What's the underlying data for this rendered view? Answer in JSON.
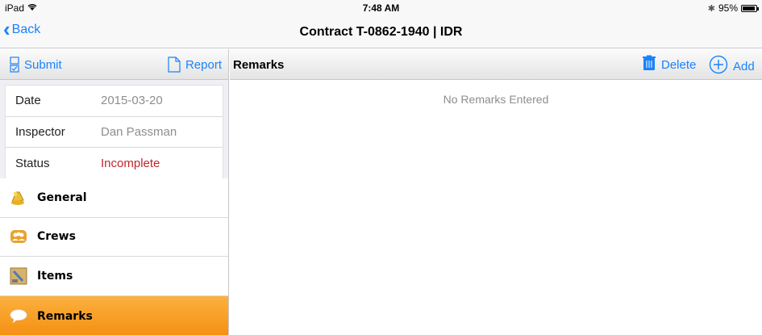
{
  "status_bar": {
    "device": "iPad",
    "time": "7:48 AM",
    "battery": "95%"
  },
  "nav": {
    "back_label": "Back",
    "title": "Contract T-0862-1940 | IDR"
  },
  "left_toolbar": {
    "submit_label": "Submit",
    "report_label": "Report"
  },
  "info": {
    "rows": [
      {
        "label": "Date",
        "value": "2015-03-20"
      },
      {
        "label": "Inspector",
        "value": "Dan Passman"
      },
      {
        "label": "Status",
        "value": "Incomplete"
      }
    ]
  },
  "menu": {
    "items": [
      {
        "label": "General",
        "icon": "general-icon"
      },
      {
        "label": "Crews",
        "icon": "crews-icon"
      },
      {
        "label": "Items",
        "icon": "items-icon"
      },
      {
        "label": "Remarks",
        "icon": "remarks-icon",
        "selected": true
      }
    ]
  },
  "remarks": {
    "title": "Remarks",
    "delete_label": "Delete",
    "add_label": "Add",
    "empty_text": "No Remarks Entered"
  },
  "colors": {
    "accent": "#1a82fb",
    "selected_bg": "#f7a02a",
    "status_incomplete": "#c0262d"
  }
}
